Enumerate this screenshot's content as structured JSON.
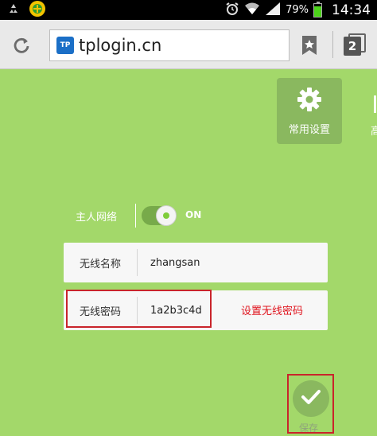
{
  "status_bar": {
    "battery_percent": "79%",
    "battery_level": 0.79,
    "time": "14:34",
    "icons": [
      "recycle-icon",
      "app-badge-icon",
      "alarm-icon",
      "wifi-icon",
      "signal-icon",
      "battery-icon"
    ]
  },
  "browser": {
    "url": "tplogin.cn",
    "favicon_text": "TP",
    "tab_count": "2"
  },
  "nav": {
    "common_settings_label": "常用设置",
    "advanced_label_partial": "高"
  },
  "form": {
    "host_network_label": "主人网络",
    "toggle_state": "ON",
    "ssid_label": "无线名称",
    "ssid_value": "zhangsan",
    "password_label": "无线密码",
    "password_value": "1a2b3c4d",
    "annotation": "设置无线密码"
  },
  "save": {
    "label": "保存"
  },
  "colors": {
    "background": "#a3d86a",
    "tile": "#8ab85f",
    "annotation_red": "#e0141e"
  }
}
